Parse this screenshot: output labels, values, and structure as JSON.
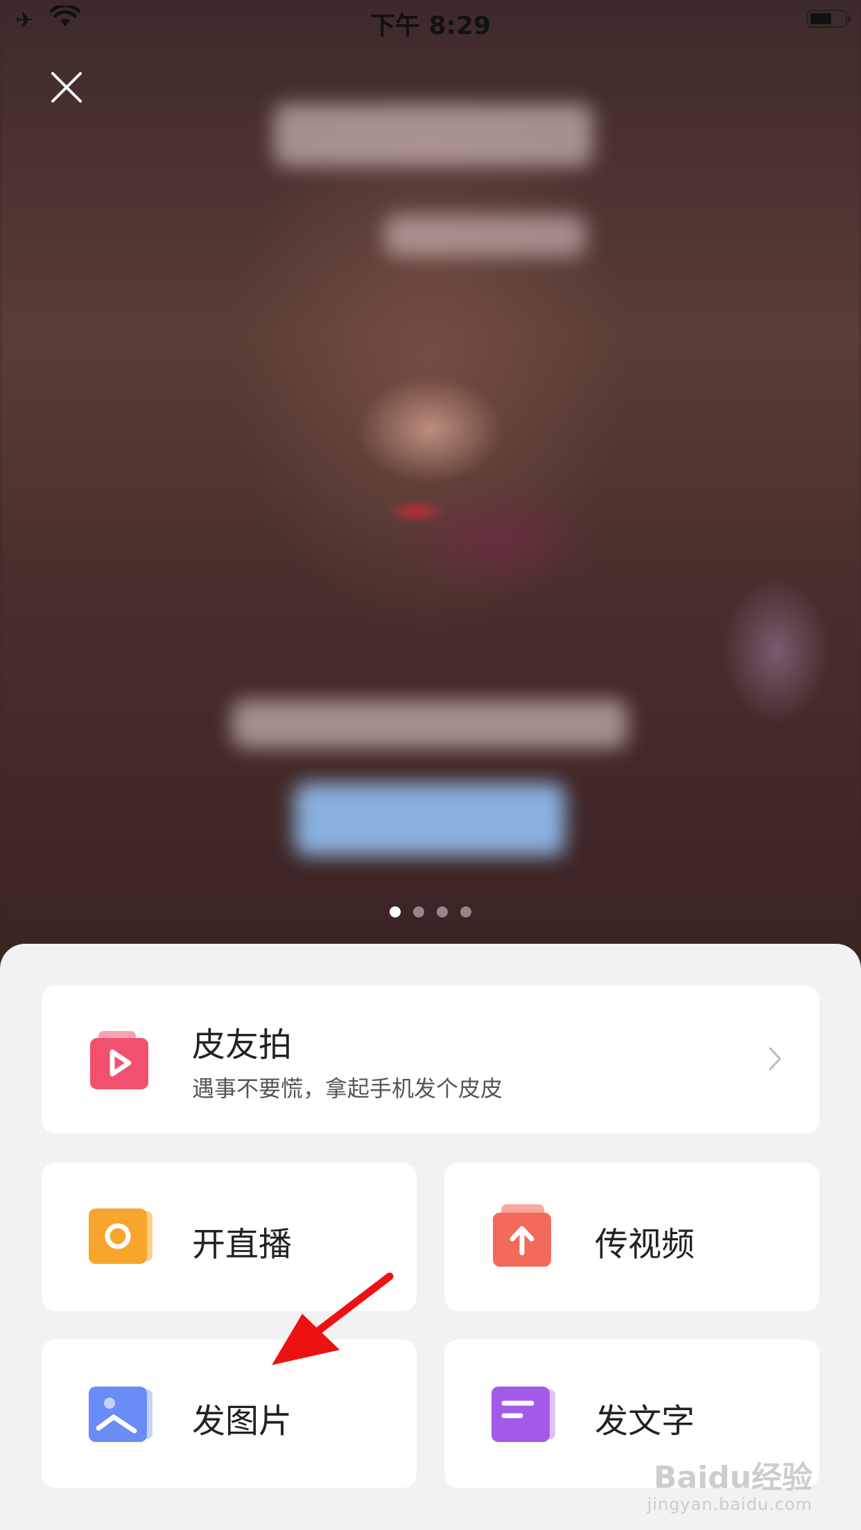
{
  "status_bar": {
    "time": "下午 8:29"
  },
  "carousel": {
    "page_count": 4,
    "active_index": 0
  },
  "menu": {
    "featured": {
      "title": "皮友拍",
      "subtitle": "遇事不要慌，拿起手机发个皮皮",
      "icon": "play-camera-icon",
      "color": "#f2506f"
    },
    "items": [
      {
        "label": "开直播",
        "icon": "live-record-icon",
        "color": "#f8a52c"
      },
      {
        "label": "传视频",
        "icon": "upload-video-icon",
        "color": "#f26a5a"
      },
      {
        "label": "发图片",
        "icon": "picture-icon",
        "color": "#6a8cf6"
      },
      {
        "label": "发文字",
        "icon": "text-post-icon",
        "color": "#a35ae8"
      }
    ]
  },
  "annotation": {
    "color": "#ee1111"
  },
  "watermark": {
    "brand": "Baidu经验",
    "url": "jingyan.baidu.com"
  }
}
